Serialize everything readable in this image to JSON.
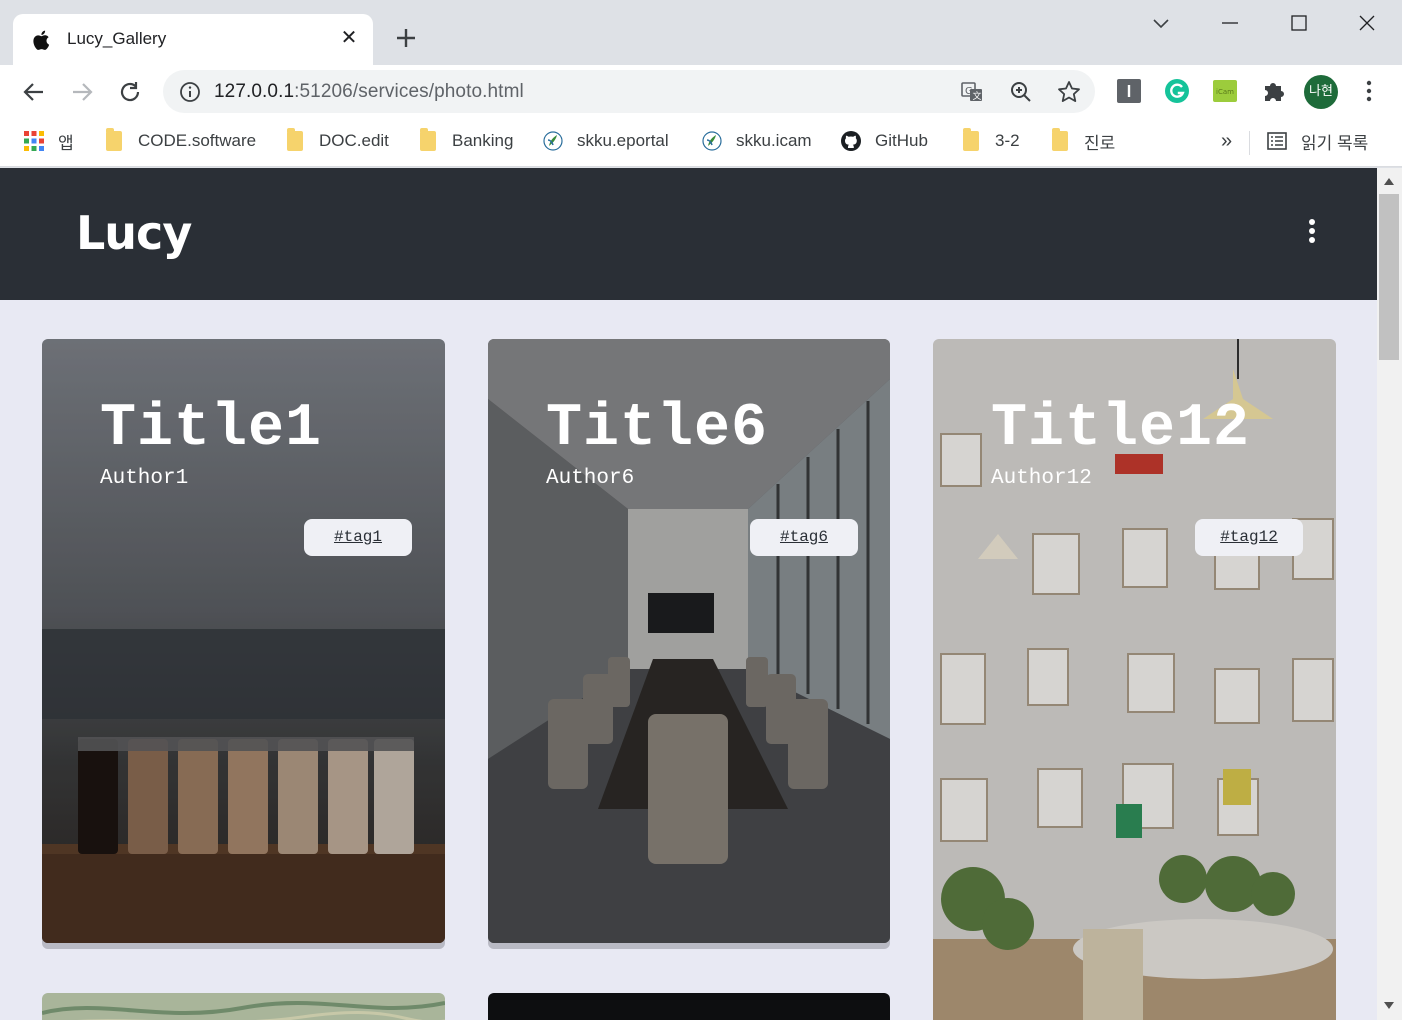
{
  "browser": {
    "tab_title": "Lucy_Gallery",
    "url_host": "127.0.0.1",
    "url_rest": ":51206/services/photo.html",
    "profile_initials": "나현",
    "bookmarks": [
      {
        "label": "앱",
        "icon": "apps-grid-icon"
      },
      {
        "label": "CODE.software",
        "icon": "folder-icon"
      },
      {
        "label": "DOC.edit",
        "icon": "folder-icon"
      },
      {
        "label": "Banking",
        "icon": "folder-icon"
      },
      {
        "label": "skku.eportal",
        "icon": "skku-icon"
      },
      {
        "label": "skku.icam",
        "icon": "skku-icon"
      },
      {
        "label": "GitHub",
        "icon": "github-icon"
      },
      {
        "label": "3-2",
        "icon": "folder-icon"
      },
      {
        "label": "진로",
        "icon": "folder-icon"
      }
    ],
    "overflow_label": "»",
    "reading_list_label": "읽기 목록"
  },
  "site": {
    "logo": "Lucy"
  },
  "cards": [
    {
      "title": "Title1",
      "author": "Author1",
      "tag": "#tag1",
      "scene": "coffee-jars"
    },
    {
      "title": "Title6",
      "author": "Author6",
      "tag": "#tag6",
      "scene": "conference-room"
    },
    {
      "title": "Title12",
      "author": "Author12",
      "tag": "#tag12",
      "scene": "clipboard-wall"
    }
  ],
  "colors": {
    "header_bg": "#2a2f36",
    "page_bg": "#e8e9f3",
    "tag_bg": "#eff0f5"
  }
}
